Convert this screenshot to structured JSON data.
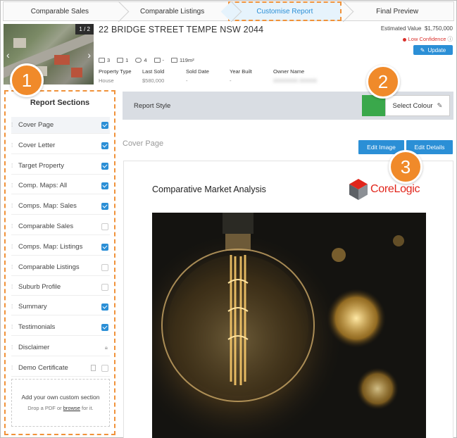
{
  "steps": [
    {
      "label": "Comparable Sales",
      "active": false
    },
    {
      "label": "Comparable Listings",
      "active": false
    },
    {
      "label": "Customise Report",
      "active": true
    },
    {
      "label": "Final Preview",
      "active": false
    }
  ],
  "property": {
    "photo_counter": "1 / 2",
    "address": "22 BRIDGE STREET TEMPE NSW 2044",
    "estimated_value_label": "Estimated Value",
    "estimated_value": "$1,750,000",
    "confidence": "Low Confidence",
    "update_label": "Update",
    "beds": "3",
    "baths": "1",
    "cars": "4",
    "other": "-",
    "land_size": "119m²",
    "meta": [
      {
        "key": "Property Type",
        "value": "House"
      },
      {
        "key": "Last Sold",
        "value": "$580,000"
      },
      {
        "key": "Sold Date",
        "value": "-"
      },
      {
        "key": "Year Built",
        "value": "-"
      },
      {
        "key": "Owner Name",
        "value": "XXXXXXX XXXXX"
      }
    ]
  },
  "sidebar": {
    "title": "Report Sections",
    "sections": [
      {
        "label": "Cover Page",
        "checked": true,
        "selected": true
      },
      {
        "label": "Cover Letter",
        "checked": true
      },
      {
        "label": "Target Property",
        "checked": true
      },
      {
        "label": "Comp. Maps: All",
        "checked": true
      },
      {
        "label": "Comps. Map: Sales",
        "checked": true
      },
      {
        "label": "Comparable Sales",
        "checked": false
      },
      {
        "label": "Comps. Map: Listings",
        "checked": true
      },
      {
        "label": "Comparable Listings",
        "checked": false
      },
      {
        "label": "Suburb Profile",
        "checked": false
      },
      {
        "label": "Summary",
        "checked": true
      },
      {
        "label": "Testimonials",
        "checked": true
      },
      {
        "label": "Disclaimer",
        "locked": true
      },
      {
        "label": "Demo Certificate",
        "checked": false,
        "doc": true
      }
    ],
    "custom_title": "Add your own custom section",
    "custom_sub_pre": "Drop a PDF or",
    "custom_sub_link": "browse",
    "custom_sub_post": "for it."
  },
  "report_style": {
    "label": "Report Style",
    "swatch_color": "#3aa84b",
    "select_colour_label": "Select Colour"
  },
  "cover": {
    "label": "Cover Page",
    "edit_image": "Edit Image",
    "edit_details": "Edit Details",
    "heading": "Comparative Market Analysis",
    "logo_text": "CoreLogic"
  },
  "badges": [
    "1",
    "2",
    "3"
  ],
  "colors": {
    "accent": "#2b8fd6",
    "orange": "#f08a2a",
    "logo_red": "#e1251b"
  }
}
